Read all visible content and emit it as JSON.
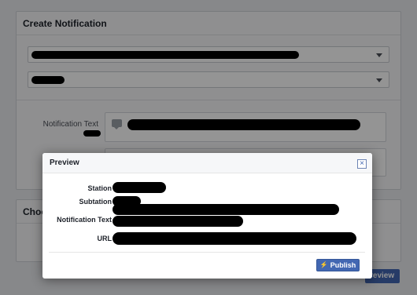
{
  "page": {
    "create_panel": {
      "title": "Create Notification"
    },
    "choose_panel": {
      "title": "Choo"
    },
    "notification_text_label": "Notification Text",
    "preview_button_label": "review"
  },
  "dialog": {
    "title": "Preview",
    "close_icon": "close-x",
    "fields": {
      "station_label": "Station",
      "subtation_label": "Subtation",
      "notification_text_label": "Notification Text",
      "url_label": "URL"
    },
    "publish_label": "Publish",
    "publish_icon": "lightning-bolt"
  },
  "colors": {
    "accent": "#4267b2",
    "overlay": "rgba(0,0,0,0.42)",
    "redaction": "#000000"
  }
}
